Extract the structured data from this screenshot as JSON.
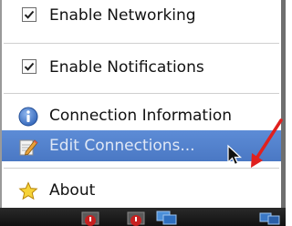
{
  "menu": {
    "items": [
      {
        "label": "Enable Networking",
        "checked": true,
        "icon": "checkbox-checked"
      },
      {
        "label": "Enable Notifications",
        "checked": true,
        "icon": "checkbox-checked"
      },
      {
        "label": "Connection Information",
        "icon": "info-icon"
      },
      {
        "label": "Edit Connections...",
        "icon": "edit-pencil-icon",
        "highlighted": true
      },
      {
        "label": "About",
        "icon": "star-icon"
      }
    ]
  },
  "annotation": {
    "color": "#e0201e"
  },
  "colors": {
    "highlight": "#5584cf",
    "menu_bg": "#ffffff",
    "taskbar": "#1a1a1a"
  },
  "taskbar": {
    "icons": [
      "warning-app-icon",
      "warning-app-icon",
      "network-icon",
      "network-icon"
    ]
  }
}
